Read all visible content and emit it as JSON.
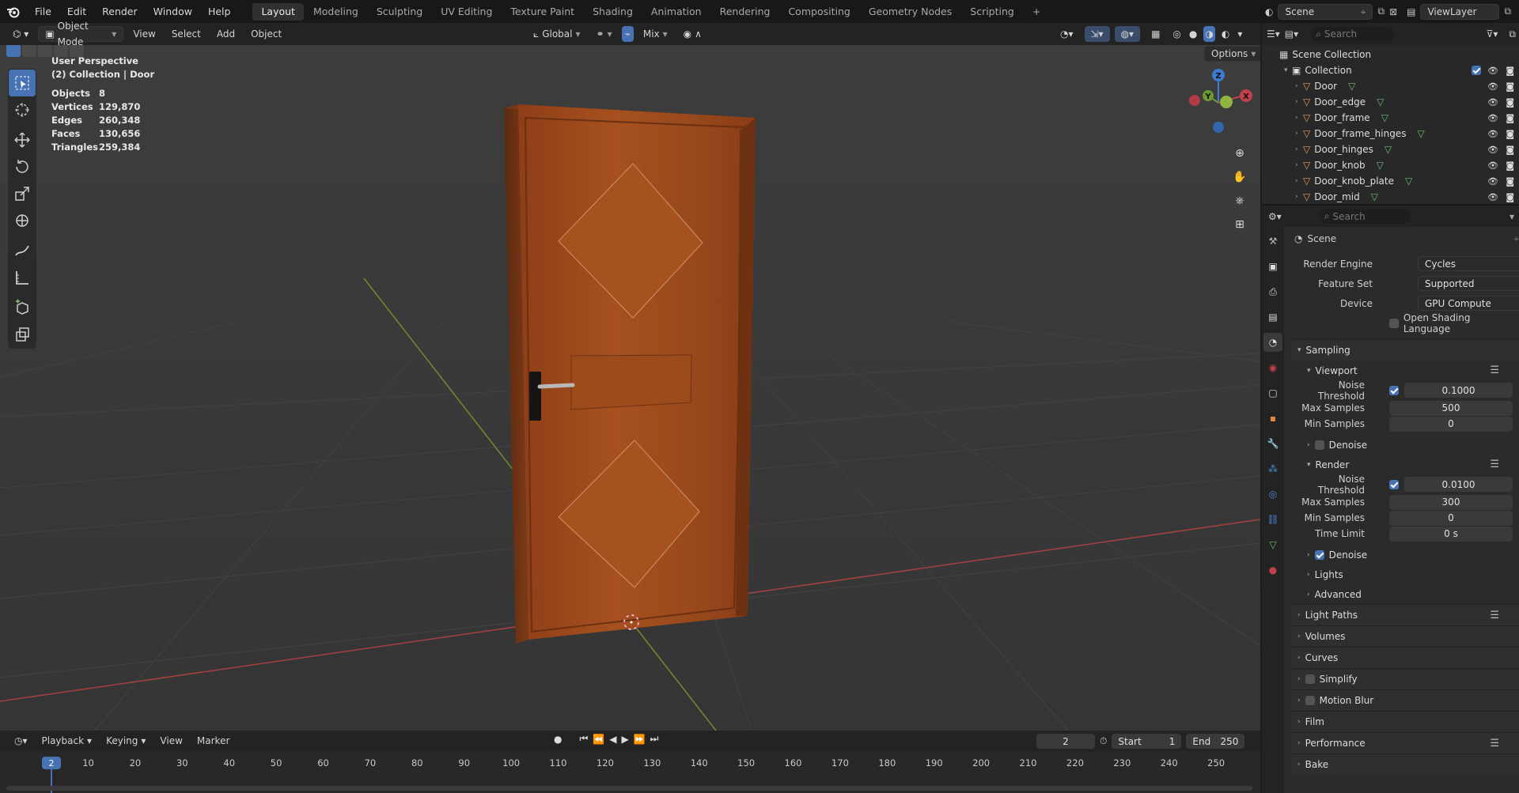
{
  "menu": {
    "items": [
      "File",
      "Edit",
      "Render",
      "Window",
      "Help"
    ]
  },
  "workspaces": {
    "tabs": [
      "Layout",
      "Modeling",
      "Sculpting",
      "UV Editing",
      "Texture Paint",
      "Shading",
      "Animation",
      "Rendering",
      "Compositing",
      "Geometry Nodes",
      "Scripting"
    ],
    "active": "Layout",
    "add": "+"
  },
  "topright": {
    "scene": "Scene",
    "view_layer": "ViewLayer"
  },
  "viewport_header": {
    "mode": "Object Mode",
    "menus": [
      "View",
      "Select",
      "Add",
      "Object"
    ],
    "transform": "Global",
    "snap": "Mix",
    "options": "Options"
  },
  "overlay": {
    "perspective": "User Perspective",
    "collection": "(2) Collection | Door",
    "stats": [
      {
        "label": "Objects",
        "value": "8"
      },
      {
        "label": "Vertices",
        "value": "129,870"
      },
      {
        "label": "Edges",
        "value": "260,348"
      },
      {
        "label": "Faces",
        "value": "130,656"
      },
      {
        "label": "Triangles",
        "value": "259,384"
      }
    ]
  },
  "gizmo": {
    "z": "Z",
    "y": "Y",
    "x": "X"
  },
  "outliner": {
    "search_placeholder": "Search",
    "scene_collection": "Scene Collection",
    "collection": "Collection",
    "objects": [
      "Door",
      "Door_edge",
      "Door_frame",
      "Door_frame_hinges",
      "Door_hinges",
      "Door_knob",
      "Door_knob_plate",
      "Door_mid"
    ]
  },
  "properties": {
    "search_placeholder": "Search",
    "context": "Scene",
    "render_engine": {
      "label": "Render Engine",
      "value": "Cycles"
    },
    "feature_set": {
      "label": "Feature Set",
      "value": "Supported"
    },
    "device": {
      "label": "Device",
      "value": "GPU Compute"
    },
    "osl": "Open Shading Language",
    "sampling": "Sampling",
    "viewport": {
      "title": "Viewport",
      "noise_label": "Noise Threshold",
      "noise": "0.1000",
      "max_label": "Max Samples",
      "max": "500",
      "min_label": "Min Samples",
      "min": "0"
    },
    "denoise_viewport": "Denoise",
    "render": {
      "title": "Render",
      "noise_label": "Noise Threshold",
      "noise": "0.0100",
      "max_label": "Max Samples",
      "max": "300",
      "min_label": "Min Samples",
      "min": "0",
      "time_label": "Time Limit",
      "time": "0 s"
    },
    "denoise_render": "Denoise",
    "lights": "Lights",
    "advanced": "Advanced",
    "sections": [
      "Light Paths",
      "Volumes",
      "Curves",
      "Simplify",
      "Motion Blur",
      "Film",
      "Performance",
      "Bake"
    ]
  },
  "timeline": {
    "menus": [
      "Playback",
      "Keying",
      "View",
      "Marker"
    ],
    "current_frame": "2",
    "start_label": "Start",
    "start": "1",
    "end_label": "End",
    "end": "250",
    "ticks": [
      "10",
      "20",
      "30",
      "40",
      "50",
      "60",
      "70",
      "80",
      "90",
      "100",
      "110",
      "120",
      "130",
      "140",
      "150",
      "160",
      "170",
      "180",
      "190",
      "200",
      "210",
      "220",
      "230",
      "240",
      "250"
    ],
    "playhead": "2"
  },
  "colors": {
    "accent": "#4772b3",
    "x_axis": "#c2404c",
    "y_axis": "#6d9a2e",
    "wood": "#a24a1c"
  }
}
